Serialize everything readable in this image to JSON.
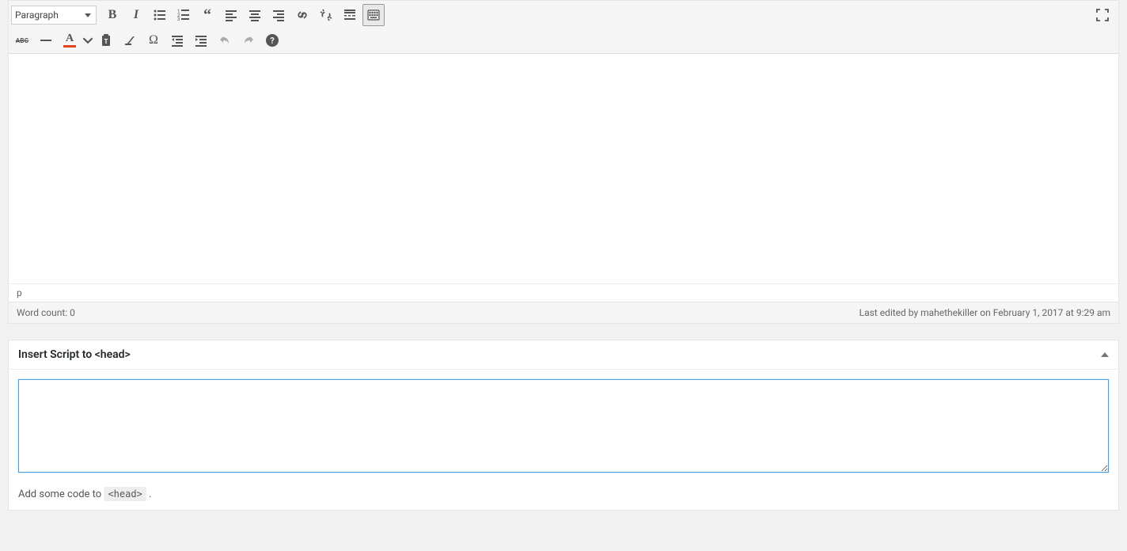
{
  "format": {
    "selected": "Paragraph"
  },
  "toolbar": {
    "row1": {
      "bold": "bold-icon",
      "italic": "italic-icon",
      "bullets": "unordered-list-icon",
      "numbers": "ordered-list-icon",
      "quote": "quote-icon",
      "align_left": "align-left-icon",
      "align_center": "align-center-icon",
      "align_right": "align-right-icon",
      "link": "link-icon",
      "unlink": "unlink-icon",
      "more": "read-more-icon",
      "kitchen": "toolbar-toggle-icon",
      "expand": "fullscreen-icon"
    },
    "row2": {
      "strike_label": "ABC",
      "hr": "horizontal-rule-icon",
      "color": "text-color-icon",
      "paste": "paste-text-icon",
      "clear": "clear-formatting-icon",
      "special": "special-char-icon",
      "outdent": "outdent-icon",
      "indent": "indent-icon",
      "undo": "undo-icon",
      "redo": "redo-icon",
      "help": "help-icon"
    }
  },
  "editor": {
    "path": "p",
    "word_count_label": "Word count: 0",
    "last_edited": "Last edited by mahethekiller on February 1, 2017 at 9:29 am"
  },
  "metabox": {
    "title": "Insert Script to <head>",
    "textarea_value": "",
    "hint_prefix": "Add some code to ",
    "hint_code": "<head>",
    "hint_suffix": " ."
  }
}
